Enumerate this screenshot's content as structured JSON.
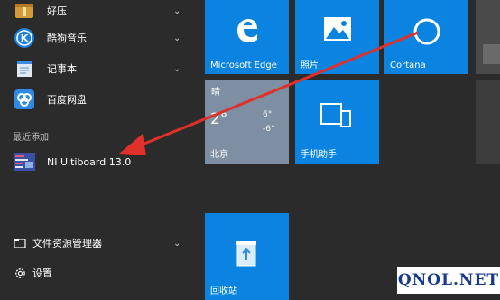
{
  "apps": [
    {
      "label": "好压",
      "has_submenu": true,
      "icon": "haozip-icon"
    },
    {
      "label": "酷狗音乐",
      "has_submenu": true,
      "icon": "kugou-icon"
    },
    {
      "label": "记事本",
      "has_submenu": true,
      "icon": "notepad-icon"
    },
    {
      "label": "百度网盘",
      "has_submenu": false,
      "icon": "baidu-netdisk-icon"
    }
  ],
  "recent": {
    "header": "最近添加",
    "item": {
      "label": "NI Ultiboard 13.0",
      "icon": "ultiboard-icon"
    }
  },
  "bottom": {
    "explorer": {
      "label": "文件资源管理器",
      "icon": "file-explorer-icon"
    },
    "settings": {
      "label": "设置",
      "icon": "gear-icon"
    }
  },
  "tiles": {
    "edge": {
      "label": "Microsoft Edge",
      "icon": "edge-icon"
    },
    "photos": {
      "label": "照片",
      "icon": "photos-icon"
    },
    "cortana": {
      "label": "Cortana",
      "icon": "cortana-icon"
    },
    "weather": {
      "condition": "晴",
      "temp": "2°",
      "high": "6°",
      "low": "-6°",
      "city": "北京"
    },
    "phone": {
      "label": "手机助手",
      "icon": "phone-companion-icon"
    },
    "recycle": {
      "label": "回收站",
      "icon": "recycle-bin-icon"
    }
  },
  "annotation": {
    "color": "#e0302a"
  },
  "watermark": "QNOL.NET",
  "colors": {
    "tile_blue": "#0a84e0",
    "background": "#2b2b2b"
  }
}
